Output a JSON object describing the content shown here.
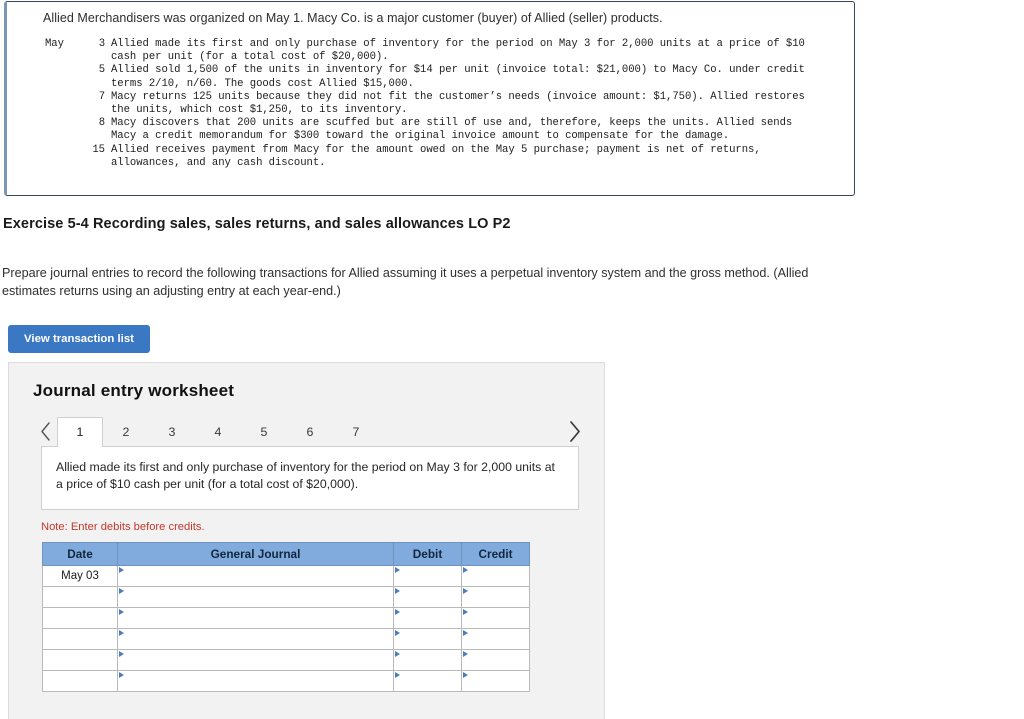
{
  "transaction_box": {
    "intro": "Allied Merchandisers was organized on May 1. Macy Co. is a major customer (buyer) of Allied (seller) products.",
    "month_label": "May",
    "entries": [
      {
        "day": "3",
        "text": "Allied made its first and only purchase of inventory for the period on May 3 for 2,000 units at a price of $10\ncash per unit (for a total cost of $20,000)."
      },
      {
        "day": "5",
        "text": "Allied sold 1,500 of the units in inventory for $14 per unit (invoice total: $21,000) to Macy Co. under credit\nterms 2/10, n/60. The goods cost Allied $15,000."
      },
      {
        "day": "7",
        "text": "Macy returns 125 units because they did not fit the customer’s needs (invoice amount: $1,750). Allied restores\nthe units, which cost $1,250, to its inventory."
      },
      {
        "day": "8",
        "text": "Macy discovers that 200 units are scuffed but are still of use and, therefore, keeps the units. Allied sends\nMacy a credit memorandum for $300 toward the original invoice amount to compensate for the damage."
      },
      {
        "day": "15",
        "text": "Allied receives payment from Macy for the amount owed on the May 5 purchase; payment is net of returns,\nallowances, and any cash discount."
      }
    ]
  },
  "exercise": {
    "title": "Exercise 5-4 Recording sales, sales returns, and sales allowances LO P2",
    "description": "Prepare journal entries to record the following transactions for Allied assuming it uses a perpetual inventory system and the gross method. (Allied estimates returns using an adjusting entry at each year-end.)",
    "view_transaction_list_label": "View transaction list"
  },
  "worksheet": {
    "title": "Journal entry worksheet",
    "prev_arrow": "‹",
    "next_arrow": "›",
    "tabs": [
      {
        "label": "1",
        "active": true
      },
      {
        "label": "2",
        "active": false
      },
      {
        "label": "3",
        "active": false
      },
      {
        "label": "4",
        "active": false
      },
      {
        "label": "5",
        "active": false
      },
      {
        "label": "6",
        "active": false
      },
      {
        "label": "7",
        "active": false
      }
    ],
    "active_tab_text": "Allied made its first and only purchase of inventory for the period on May 3 for 2,000 units at a price of $10 cash per unit (for a total cost of $20,000).",
    "note": "Note: Enter debits before credits.",
    "table": {
      "headers": [
        "Date",
        "General Journal",
        "Debit",
        "Credit"
      ],
      "rows": [
        {
          "date": "May 03",
          "general_journal": "",
          "debit": "",
          "credit": ""
        },
        {
          "date": "",
          "general_journal": "",
          "debit": "",
          "credit": ""
        },
        {
          "date": "",
          "general_journal": "",
          "debit": "",
          "credit": ""
        },
        {
          "date": "",
          "general_journal": "",
          "debit": "",
          "credit": ""
        },
        {
          "date": "",
          "general_journal": "",
          "debit": "",
          "credit": ""
        },
        {
          "date": "",
          "general_journal": "",
          "debit": "",
          "credit": ""
        }
      ]
    }
  },
  "colors": {
    "accent_blue": "#3a78c3",
    "table_header_blue": "#82abdd",
    "input_border_blue": "#4a7ebb",
    "note_red": "#c0392b",
    "panel_gray": "#f2f2f2",
    "box_border": "#33475b"
  }
}
